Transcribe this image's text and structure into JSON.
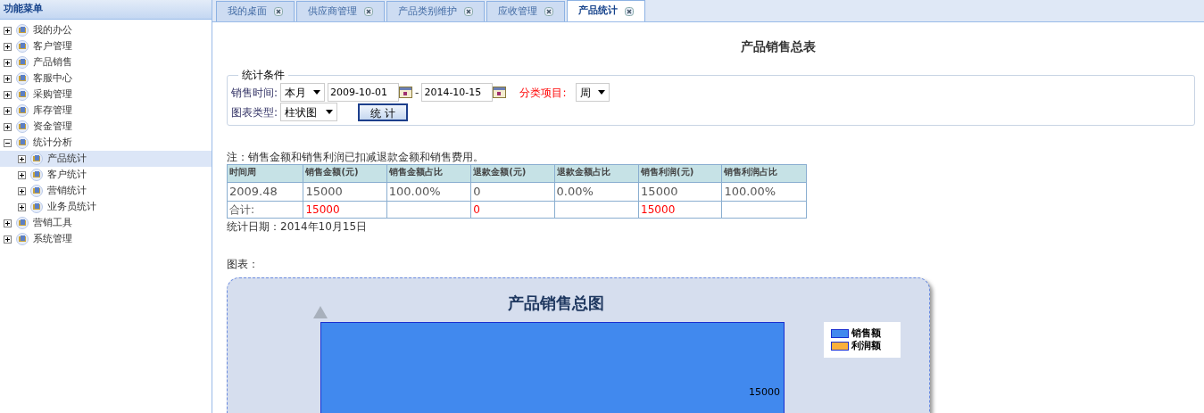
{
  "sidebar": {
    "title": "功能菜单",
    "items": [
      {
        "label": "我的办公",
        "expanded": false,
        "selected": false
      },
      {
        "label": "客户管理",
        "expanded": false,
        "selected": false
      },
      {
        "label": "产品销售",
        "expanded": false,
        "selected": false
      },
      {
        "label": "客服中心",
        "expanded": false,
        "selected": false
      },
      {
        "label": "采购管理",
        "expanded": false,
        "selected": false
      },
      {
        "label": "库存管理",
        "expanded": false,
        "selected": false
      },
      {
        "label": "资金管理",
        "expanded": false,
        "selected": false
      },
      {
        "label": "统计分析",
        "expanded": true,
        "selected": false,
        "children": [
          {
            "label": "产品统计",
            "expanded": false,
            "selected": true
          },
          {
            "label": "客户统计",
            "expanded": false,
            "selected": false
          },
          {
            "label": "营销统计",
            "expanded": false,
            "selected": false
          },
          {
            "label": "业务员统计",
            "expanded": false,
            "selected": false
          }
        ]
      },
      {
        "label": "营销工具",
        "expanded": false,
        "selected": false
      },
      {
        "label": "系统管理",
        "expanded": false,
        "selected": false
      }
    ]
  },
  "tabs": [
    {
      "label": "我的桌面",
      "selected": false
    },
    {
      "label": "供应商管理",
      "selected": false
    },
    {
      "label": "产品类别维护",
      "selected": false
    },
    {
      "label": "应收管理",
      "selected": false
    },
    {
      "label": "产品统计",
      "selected": true
    }
  ],
  "page": {
    "title": "产品销售总表",
    "conditions": {
      "legend": "统计条件",
      "time_label": "销售时间:",
      "period": "本月",
      "start_date": "2009-10-01",
      "separator": "-",
      "end_date": "2014-10-15",
      "category_label": "分类项目:",
      "category": "周",
      "chart_type_label": "图表类型:",
      "chart_type": "柱状图",
      "submit": "统 计"
    },
    "note": "注：销售金额和销售利润已扣减退款金额和销售费用。",
    "table": {
      "columns": [
        "时间周",
        "销售金额(元)",
        "销售金额占比",
        "退款金额(元)",
        "退款金额占比",
        "销售利润(元)",
        "销售利润占比"
      ],
      "rows": [
        {
          "kind": "data",
          "cells": [
            "2009.48",
            "15000",
            "100.00%",
            "0",
            "0.00%",
            "15000",
            "100.00%"
          ]
        },
        {
          "kind": "total",
          "cells": [
            "合计:",
            "15000",
            "",
            "0",
            "",
            "15000",
            ""
          ]
        }
      ]
    },
    "date_line": "统计日期：2014年10月15日",
    "chart_label": "图表：",
    "chart": {
      "title": "产品销售总图",
      "value_label": "15000",
      "legend": [
        {
          "label": "销售额",
          "color": "#4189ee"
        },
        {
          "label": "利润额",
          "color": "#fbb03b"
        }
      ]
    }
  }
}
